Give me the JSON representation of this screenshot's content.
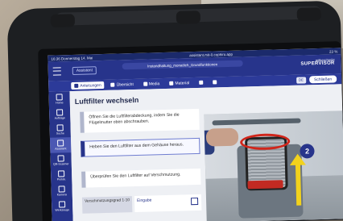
{
  "status_bar": {
    "time_date": "16:36 Donnerstag 14. Mai",
    "url": "assistant.mit-0.cophiro.app",
    "battery": "23 %"
  },
  "header": {
    "assistant_tag": "Assistent",
    "doc_title": "Instandhaltung_monatlich_Grundfunktionen",
    "brand_small": "mitbeschreibt",
    "brand_name": "SUPERVISOR"
  },
  "tabs": [
    {
      "label": "Anleitungen"
    },
    {
      "label": "Übersicht"
    },
    {
      "label": "Media"
    },
    {
      "label": "Material"
    }
  ],
  "header_right": {
    "zoom_label": "DE",
    "close_label": "Schließen"
  },
  "sidebar": [
    {
      "label": "Home"
    },
    {
      "label": "Aufträge"
    },
    {
      "label": "Suche"
    },
    {
      "label": "Assistent"
    },
    {
      "label": "QR-Scanner"
    },
    {
      "label": "Protok."
    },
    {
      "label": "Kamera"
    },
    {
      "label": "Werkzeuge"
    }
  ],
  "content": {
    "title": "Luftfilter wechseln",
    "steps": [
      {
        "text": "Öffnen Sie die Luftfilterabdeckung, indem Sie die Flügelmutter oben abschrauben."
      },
      {
        "text": "Heben Sie den Luftfilter aus dem Gehäuse heraus."
      },
      {
        "text": "Überprüfen Sie den Luftfilter auf Verschmutzung."
      }
    ],
    "field_label": "Verschmutzungsgrad 1-10",
    "field_input": "Eingabe"
  },
  "photo": {
    "badge": "2"
  },
  "colors": {
    "brand_blue": "#27348b",
    "accent_yellow": "#f2d21c",
    "filter_red": "#d1261b"
  }
}
